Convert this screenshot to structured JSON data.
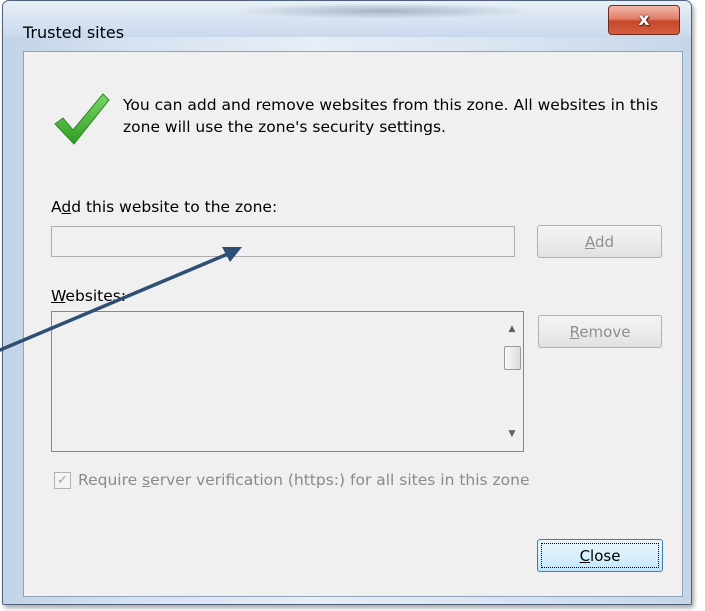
{
  "window": {
    "title": "Trusted sites",
    "close_glyph": "x"
  },
  "info": {
    "icon": "green-check-icon",
    "text": "You can add and remove websites from this zone. All websites in this zone will use the zone's security settings."
  },
  "add_section": {
    "label_pre": "A",
    "label_mnemonic": "d",
    "label_post": "d this website to the zone:",
    "input_value": "",
    "add_button_mnemonic": "A",
    "add_button_rest": "dd"
  },
  "websites_section": {
    "label_mnemonic": "W",
    "label_post": "ebsites:",
    "items": [],
    "remove_button_mnemonic": "R",
    "remove_button_rest": "emove"
  },
  "https_option": {
    "checked": true,
    "label_pre": "Require ",
    "label_mnemonic": "s",
    "label_post": "erver verification (https:) for all sites in this zone"
  },
  "footer": {
    "close_button_mnemonic": "C",
    "close_button_rest": "lose"
  },
  "colors": {
    "accent_check": "#3fae2a",
    "annotation_arrow": "#3a5a80",
    "close_button_red": "#c7472b"
  }
}
